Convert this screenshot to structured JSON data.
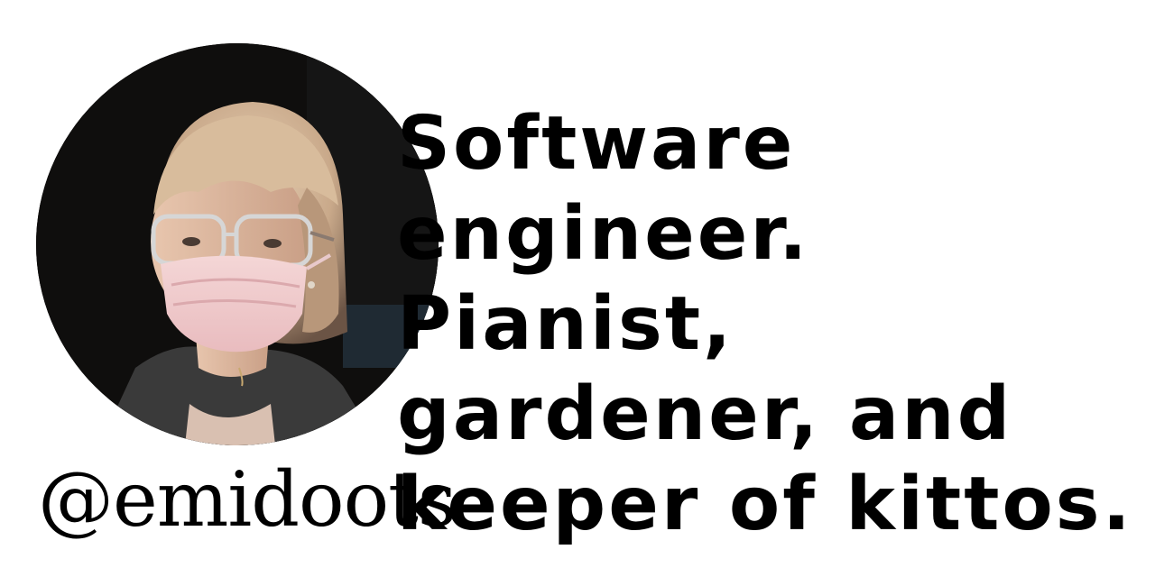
{
  "profile": {
    "handle": "@emidoots",
    "bio_lines": [
      "Software",
      "engineer.",
      "Pianist,",
      "gardener, and",
      "keeper of kittos."
    ]
  },
  "colors": {
    "background": "#ffffff",
    "text": "#000000",
    "photo_background": "#0f0e0d"
  }
}
